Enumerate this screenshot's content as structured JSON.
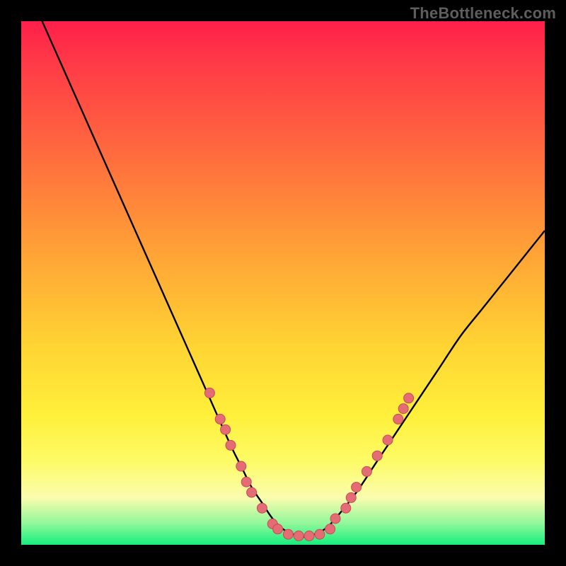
{
  "watermark": "TheBottleneck.com",
  "colors": {
    "marker_fill": "#e46c74",
    "marker_stroke": "#c94b55",
    "curve": "#000000",
    "frame": "#000000"
  },
  "chart_data": {
    "type": "line",
    "title": "",
    "xlabel": "",
    "ylabel": "",
    "xlim": [
      0,
      100
    ],
    "ylim": [
      0,
      100
    ],
    "grid": false,
    "legend": false,
    "series": [
      {
        "name": "curve",
        "x": [
          4,
          8,
          12,
          16,
          20,
          24,
          28,
          32,
          36,
          40,
          42,
          44,
          46,
          48,
          50,
          52,
          54,
          56,
          58,
          60,
          64,
          68,
          72,
          76,
          80,
          84,
          88,
          92,
          96,
          100
        ],
        "y": [
          100,
          91,
          82,
          73,
          64,
          55,
          46,
          37,
          28,
          19,
          15,
          11,
          8,
          5,
          3,
          2,
          1.5,
          2,
          3,
          5,
          10,
          16,
          22,
          28,
          34,
          40,
          45,
          50,
          55,
          60
        ]
      }
    ],
    "markers": [
      {
        "x": 36,
        "y": 29
      },
      {
        "x": 38,
        "y": 24
      },
      {
        "x": 39,
        "y": 22
      },
      {
        "x": 40,
        "y": 19
      },
      {
        "x": 42,
        "y": 15
      },
      {
        "x": 43,
        "y": 12
      },
      {
        "x": 44,
        "y": 10
      },
      {
        "x": 46,
        "y": 7
      },
      {
        "x": 48,
        "y": 4
      },
      {
        "x": 49,
        "y": 3
      },
      {
        "x": 51,
        "y": 2
      },
      {
        "x": 53,
        "y": 1.7
      },
      {
        "x": 55,
        "y": 1.7
      },
      {
        "x": 57,
        "y": 2
      },
      {
        "x": 59,
        "y": 3
      },
      {
        "x": 60,
        "y": 5
      },
      {
        "x": 62,
        "y": 7
      },
      {
        "x": 63,
        "y": 9
      },
      {
        "x": 64,
        "y": 11
      },
      {
        "x": 66,
        "y": 14
      },
      {
        "x": 68,
        "y": 17
      },
      {
        "x": 70,
        "y": 20
      },
      {
        "x": 72,
        "y": 24
      },
      {
        "x": 73,
        "y": 26
      },
      {
        "x": 74,
        "y": 28
      }
    ],
    "marker_radius": 7
  }
}
